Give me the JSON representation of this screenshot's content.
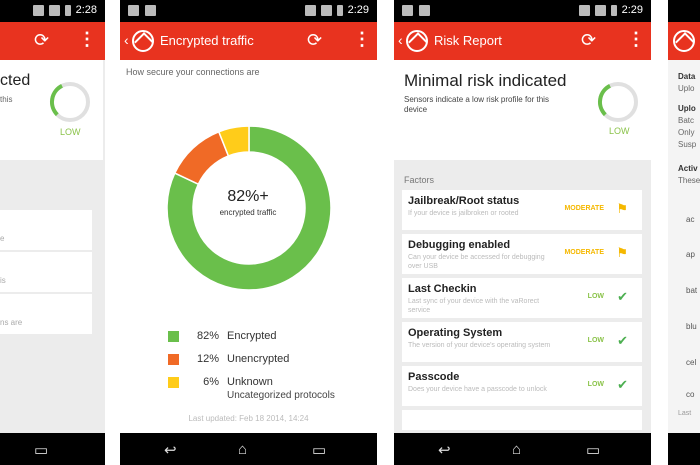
{
  "status": {
    "time_1": "2:28",
    "time_2": "2:29",
    "time_3": "2:29"
  },
  "screen1": {
    "heading_fragment": "cted",
    "sub_fragment": "this",
    "level": "LOW",
    "rows": [
      "e",
      "is",
      "ns are"
    ]
  },
  "screen2": {
    "title": "Encrypted traffic",
    "subtitle": "How secure your connections are",
    "center_value": "82%+",
    "center_label": "encrypted traffic",
    "last_updated": "Last updated: Feb 18 2014, 14:24"
  },
  "chart_data": {
    "type": "pie",
    "categories": [
      "Encrypted",
      "Unencrypted",
      "Unknown"
    ],
    "values": [
      82,
      12,
      6
    ],
    "colors": [
      "#6abf4b",
      "#f06a26",
      "#ffcc1a"
    ],
    "legend": [
      {
        "pct": "82%",
        "label": "Encrypted",
        "sub": ""
      },
      {
        "pct": "12%",
        "label": "Unencrypted",
        "sub": ""
      },
      {
        "pct": "6%",
        "label": "Unknown",
        "sub": "Uncategorized protocols"
      }
    ]
  },
  "screen3": {
    "title": "Risk Report",
    "heading": "Minimal risk indicated",
    "description": "Sensors indicate a low risk profile for this device",
    "level": "LOW",
    "factors_label": "Factors",
    "factors": [
      {
        "name": "Jailbreak/Root status",
        "desc": "If your device is jailbroken or rooted",
        "level": "MODERATE",
        "icon": "warning-flag-icon"
      },
      {
        "name": "Debugging enabled",
        "desc": "Can your device be accessed for debugging over USB",
        "level": "MODERATE",
        "icon": "warning-flag-icon"
      },
      {
        "name": "Last Checkin",
        "desc": "Last sync of your device with the vaRorect service",
        "level": "LOW",
        "icon": "check-icon"
      },
      {
        "name": "Operating System",
        "desc": "The version of your device's operating system",
        "level": "LOW",
        "icon": "check-icon"
      },
      {
        "name": "Passcode",
        "desc": "Does your device have a passcode to unlock",
        "level": "LOW",
        "icon": "check-icon"
      }
    ]
  },
  "screen4": {
    "lines": [
      "Data",
      "Uplo",
      "Uplo",
      "Batc",
      "Only",
      "Susp",
      "Activ",
      "These"
    ],
    "rows": [
      "ac",
      "ap",
      "bat",
      "blu",
      "cel",
      "co"
    ],
    "footer": "Last"
  },
  "colors": {
    "brand": "#e8331f",
    "low": "#8bc34a",
    "moderate": "#f5b800"
  }
}
